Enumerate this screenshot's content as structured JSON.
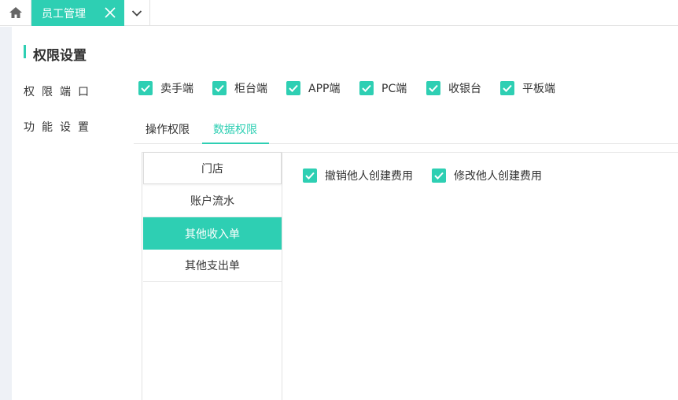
{
  "tabbar": {
    "active_tab_label": "员工管理"
  },
  "page": {
    "section_title": "权限设置",
    "port_label": "权限端口",
    "function_label": "功能设置"
  },
  "ports": [
    {
      "label": "卖手端",
      "checked": true
    },
    {
      "label": "柜台端",
      "checked": true
    },
    {
      "label": "APP端",
      "checked": true
    },
    {
      "label": "PC端",
      "checked": true
    },
    {
      "label": "收银台",
      "checked": true
    },
    {
      "label": "平板端",
      "checked": true
    }
  ],
  "function_tabs": [
    {
      "label": "操作权限",
      "active": false
    },
    {
      "label": "数据权限",
      "active": true
    }
  ],
  "categories": [
    {
      "label": "门店",
      "active": false
    },
    {
      "label": "账户流水",
      "active": false
    },
    {
      "label": "其他收入单",
      "active": true
    },
    {
      "label": "其他支出单",
      "active": false
    }
  ],
  "permissions": [
    {
      "label": "撤销他人创建费用",
      "checked": true
    },
    {
      "label": "修改他人创建费用",
      "checked": true
    }
  ],
  "colors": {
    "accent": "#2ecfb3",
    "text": "#333333",
    "sidebar_bg": "#eef1f6"
  }
}
